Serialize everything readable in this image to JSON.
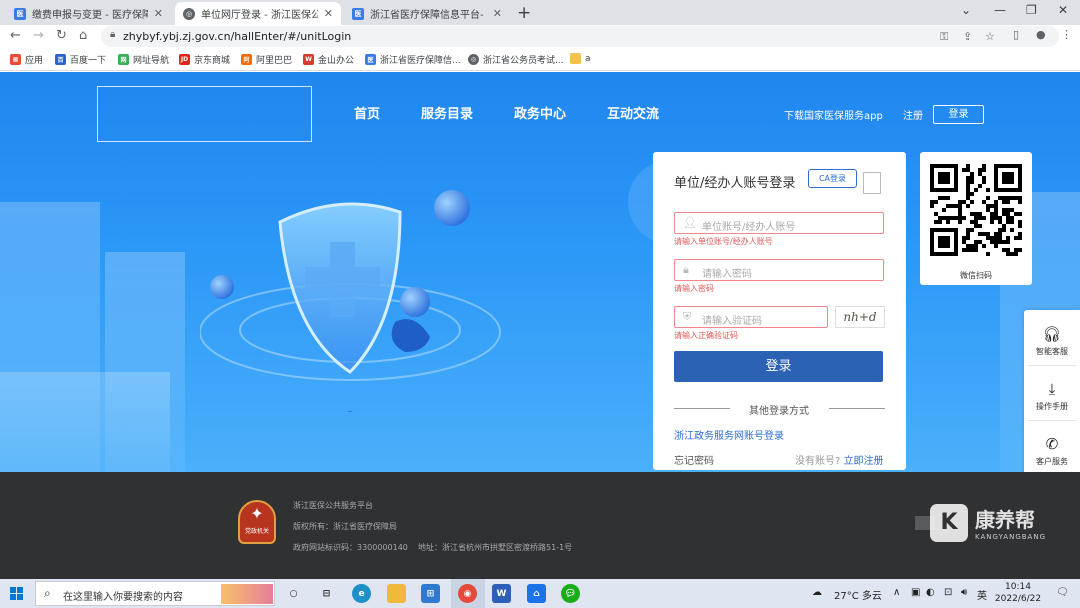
{
  "browser": {
    "tabs": [
      {
        "title": "缴费申报与变更 - 医疗保障单位网上服务",
        "active": false
      },
      {
        "title": "单位网厅登录 - 浙江医保公共服务平台",
        "active": true
      },
      {
        "title": "浙江省医疗保障信息平台-【预发布】",
        "active": false
      }
    ],
    "tab_close": "✕",
    "new_tab": "+",
    "url": "zhybyf.ybj.zj.gov.cn/hallEnter/#/unitLogin",
    "bookmarks": [
      "应用",
      "百度一下",
      "网址导航",
      "京东商城",
      "阿里巴巴",
      "金山办公",
      "浙江省医疗保障信...",
      "浙江省公务员考试...",
      "a"
    ]
  },
  "site": {
    "nav": [
      "首页",
      "服务目录",
      "政务中心",
      "互动交流"
    ],
    "download_app": "下载国家医保服务app",
    "register": "注册",
    "login": "登录"
  },
  "login": {
    "title": "单位/经办人账号登录",
    "ca_login": "CA登录",
    "account_placeholder": "单位账号/经办人账号",
    "account_error": "请输入单位账号/经办人账号",
    "password_placeholder": "请输入密码",
    "password_error": "请输入密码",
    "captcha_placeholder": "请输入验证码",
    "captcha_error": "请输入正确验证码",
    "captcha_text": "nh+d",
    "submit": "登录",
    "other_methods": "其他登录方式",
    "zhejiang_login": "浙江政务服务网账号登录",
    "forgot": "忘记密码",
    "no_account": "没有账号?",
    "register_now": "立即注册"
  },
  "qr": {
    "caption": "微信扫码"
  },
  "side_service": [
    "智能客服",
    "操作手册",
    "客户服务"
  ],
  "footer": {
    "badge_text": "党政机关",
    "platform": "浙江医保公共服务平台",
    "copyright": "版权所有：浙江省医疗保障局",
    "icp": "政府网站标识码：3300000140",
    "address": "地址：浙江省杭州市拱墅区密渡桥路51-1号"
  },
  "watermark": {
    "logo": "K",
    "name": "康养帮",
    "english": "KANGYANGBANG"
  },
  "taskbar": {
    "search_placeholder": "在这里输入你要搜索的内容",
    "weather": "27°C 多云",
    "ime": "英",
    "time": "10:14",
    "date": "2022/6/22"
  }
}
